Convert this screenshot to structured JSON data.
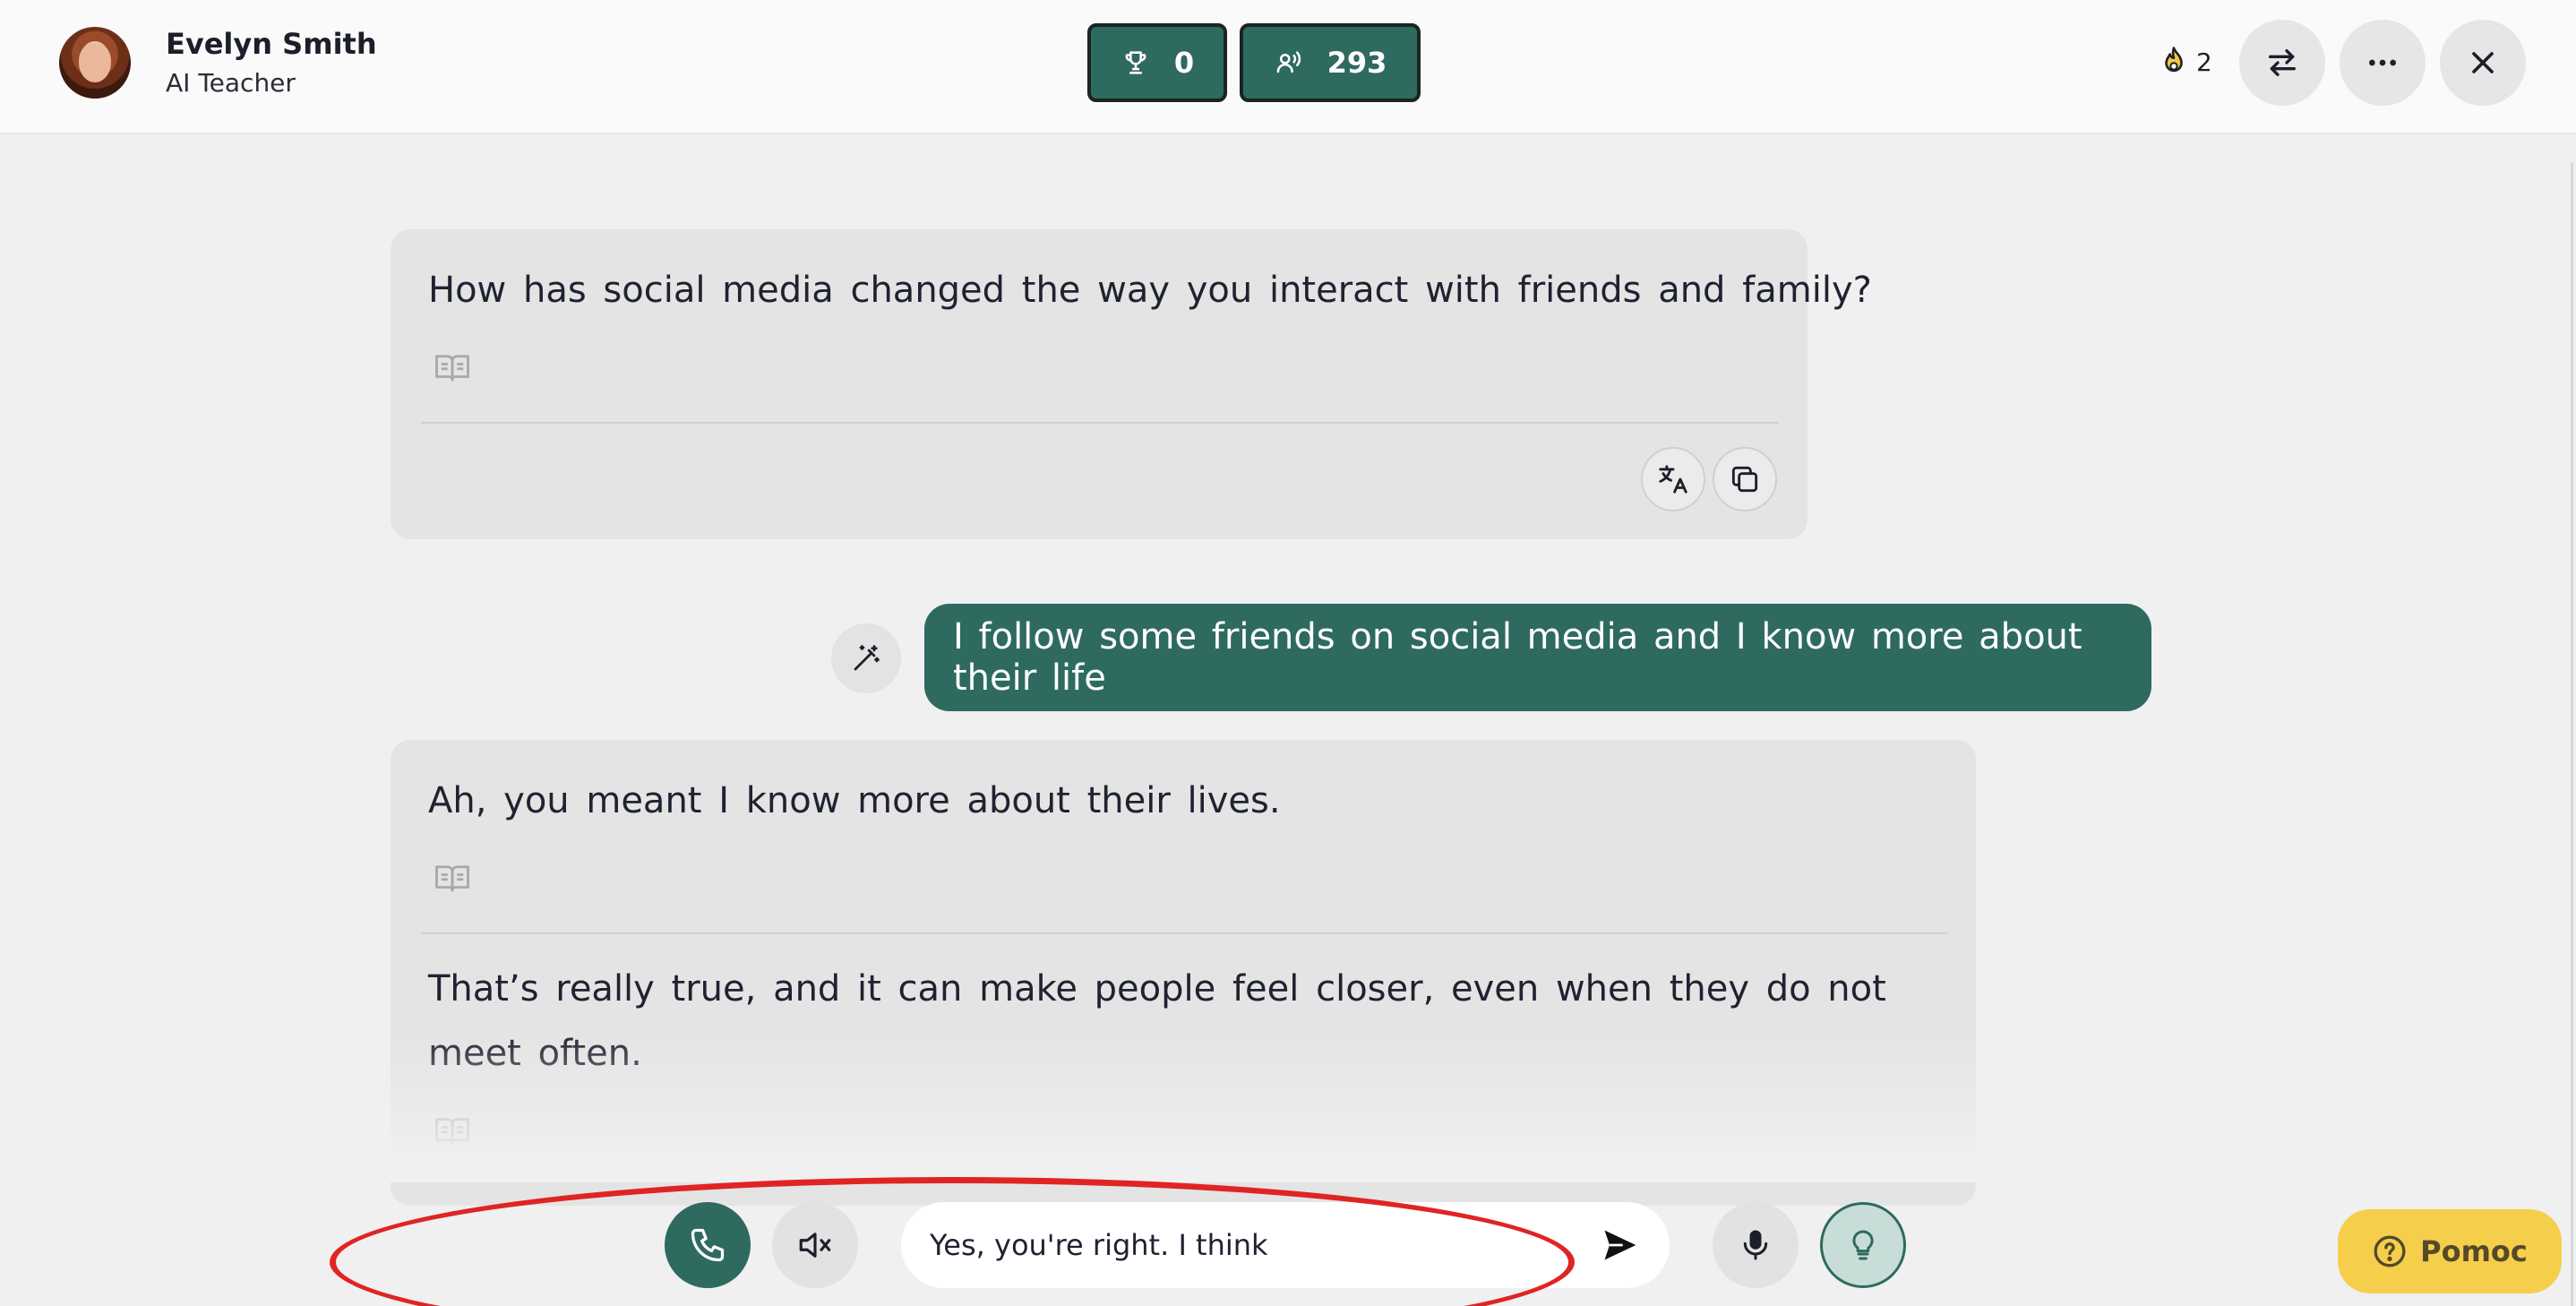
{
  "header": {
    "teacher_name": "Evelyn Smith",
    "teacher_role": "AI Teacher",
    "trophy_count": "0",
    "listen_count": "293",
    "streak_count": "2"
  },
  "messages": {
    "ai_1": {
      "text": "How has social media changed the way you interact with friends and family?"
    },
    "user_1": {
      "text": "I follow some friends on social media and I know more about their life"
    },
    "ai_2": {
      "correction": "Ah, you meant I know more about their lives.",
      "reply": "That’s really true, and it can make people feel closer, even when they do not meet often."
    }
  },
  "composer": {
    "input_value": "Yes, you're right. I think"
  },
  "help": {
    "label": "Pomoc"
  },
  "colors": {
    "accent": "#2e6a5f",
    "help": "#f5cf4c",
    "annotation": "#e02424"
  }
}
